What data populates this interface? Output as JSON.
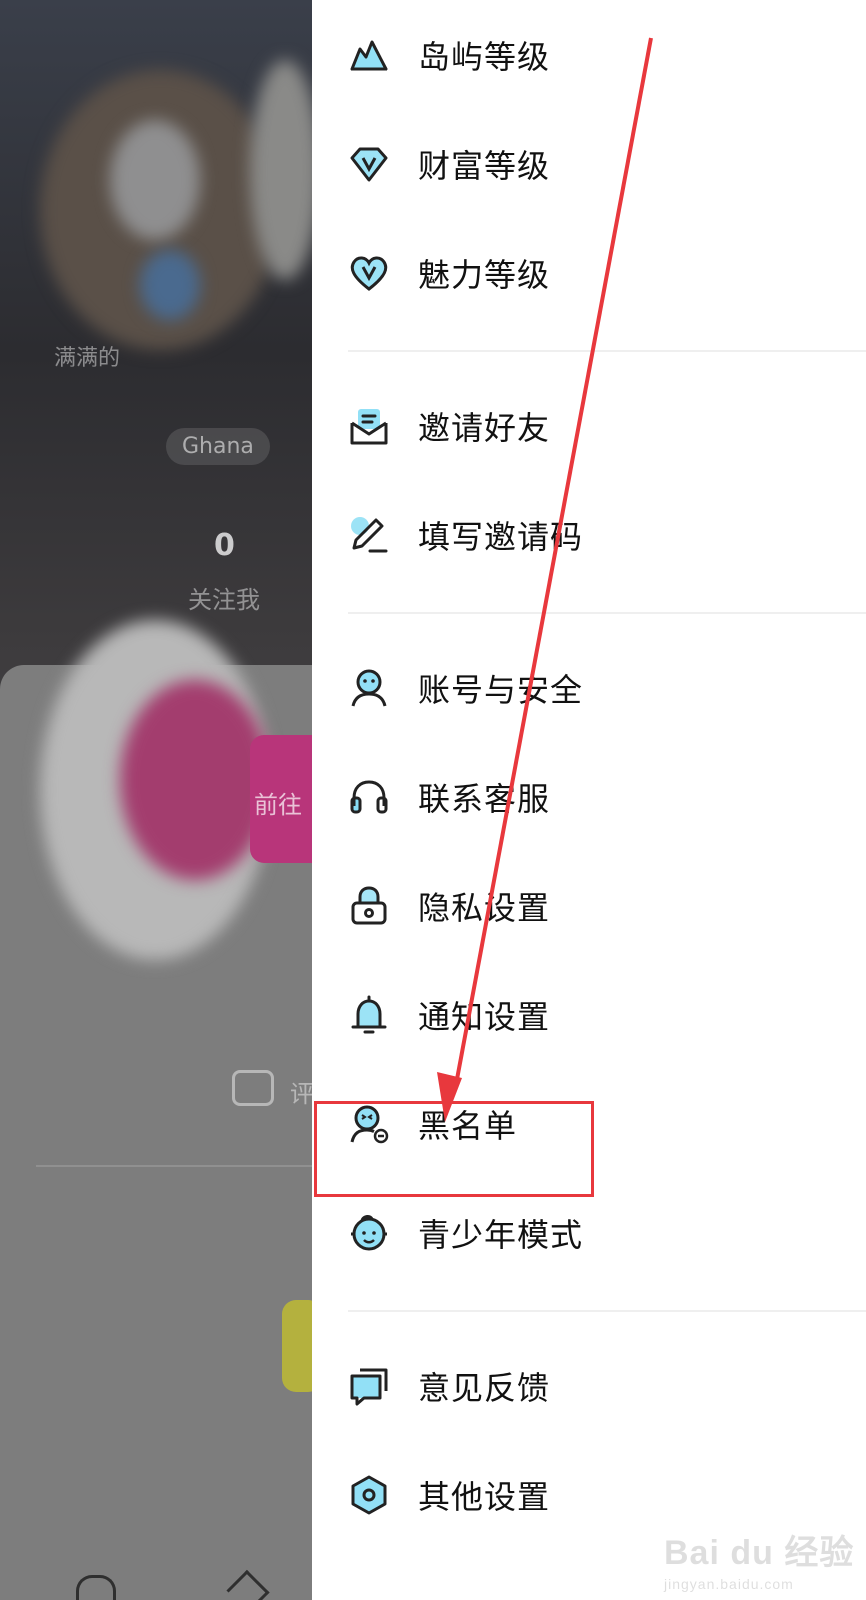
{
  "background_page": {
    "blurred_caption": "满满的",
    "tag": "Ghana",
    "follower_count": "0",
    "follower_label": "关注我",
    "action_button_partial": "前往",
    "comment_partial": "评"
  },
  "drawer": {
    "groups": [
      {
        "items": [
          {
            "label": "岛屿等级",
            "icon": "island-icon"
          },
          {
            "label": "财富等级",
            "icon": "wealth-diamond-icon"
          },
          {
            "label": "魅力等级",
            "icon": "charm-heart-icon"
          }
        ]
      },
      {
        "items": [
          {
            "label": "邀请好友",
            "icon": "invite-envelope-icon"
          },
          {
            "label": "填写邀请码",
            "icon": "pencil-icon"
          }
        ]
      },
      {
        "items": [
          {
            "label": "账号与安全",
            "icon": "account-person-icon"
          },
          {
            "label": "联系客服",
            "icon": "headset-icon"
          },
          {
            "label": "隐私设置",
            "icon": "lock-icon"
          },
          {
            "label": "通知设置",
            "icon": "bell-icon"
          },
          {
            "label": "黑名单",
            "icon": "blocked-user-icon"
          },
          {
            "label": "青少年模式",
            "icon": "child-face-icon"
          }
        ]
      },
      {
        "items": [
          {
            "label": "意见反馈",
            "icon": "feedback-chat-icon"
          },
          {
            "label": "其他设置",
            "icon": "hexagon-settings-icon"
          }
        ]
      }
    ]
  },
  "annotation": {
    "highlighted_item": "黑名单",
    "arrow_color": "#e8383d"
  },
  "watermark": {
    "brand": "Bai du 经验",
    "url": "jingyan.baidu.com"
  },
  "colors": {
    "icon_accent": "#39c7ee",
    "icon_stroke": "#222222",
    "text": "#111111"
  }
}
